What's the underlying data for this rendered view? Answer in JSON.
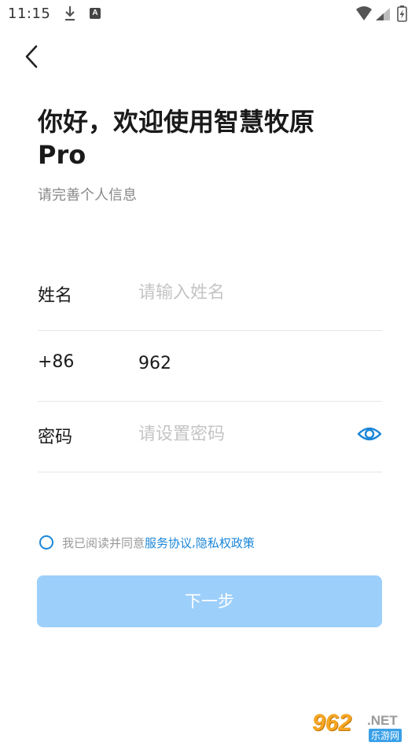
{
  "status_bar": {
    "time": "11:15",
    "notification_icons": [
      "download-icon",
      "app-a-icon"
    ],
    "a_badge": "A",
    "right_icons": [
      "wifi-icon",
      "signal-icon",
      "battery-charging-icon"
    ]
  },
  "nav": {
    "back_icon": "chevron-left-icon"
  },
  "header": {
    "title_line1": "你好，欢迎使用智慧牧原",
    "title_line2": "Pro",
    "subtitle": "请完善个人信息"
  },
  "form": {
    "name": {
      "label": "姓名",
      "placeholder": "请输入姓名",
      "value": ""
    },
    "phone": {
      "label": "+86",
      "value": "962"
    },
    "password": {
      "label": "密码",
      "placeholder": "请设置密码",
      "value": "",
      "toggle_icon": "eye-icon"
    }
  },
  "agreement": {
    "checked": false,
    "text": "我已阅读并同意",
    "service_link": "服务协议",
    "separator": ",",
    "privacy_link": "隐私权政策"
  },
  "next_button": {
    "label": "下一步",
    "enabled": false
  },
  "watermark": {
    "brand": "962",
    "suffix": ".NET",
    "sub": "乐游网"
  },
  "colors": {
    "accent": "#1a86d8",
    "button_disabled": "#9dcffb",
    "placeholder": "#c4c4c4",
    "subtitle": "#888888",
    "divider": "#e6e6e6"
  }
}
